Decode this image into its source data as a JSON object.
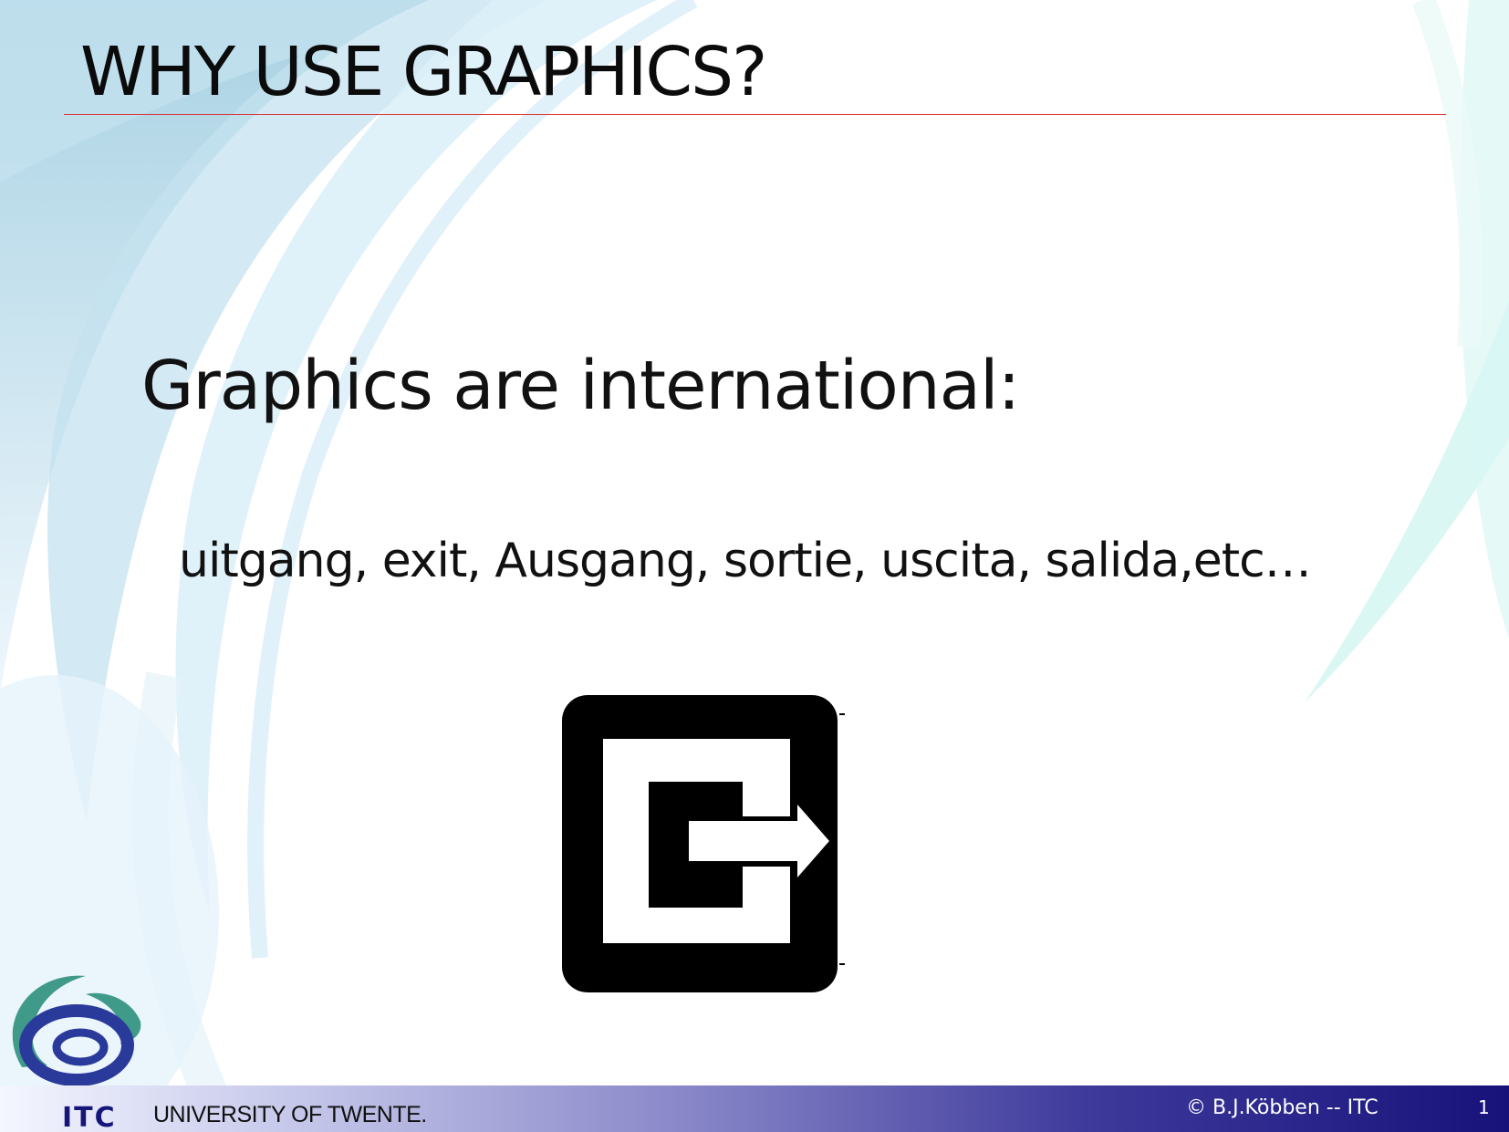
{
  "slide": {
    "title": "WHY USE GRAPHICS?",
    "heading": "Graphics are international:",
    "subtext": "uitgang, exit, Ausgang, sortie, uscita, salida,etc…"
  },
  "graphic": {
    "icon": "exit-sign-icon"
  },
  "footer": {
    "logo_text": "ITC",
    "university": "UNIVERSITY OF TWENTE.",
    "copyright": "© B.J.Köbben --  ITC",
    "page_number": "1"
  },
  "colors": {
    "title_rule": "#d83a3a",
    "swoosh_light": "#b7d9e8",
    "swoosh_pale": "#e3f4fb",
    "footer_dark": "#16127a",
    "logo_teal": "#3f9a8a",
    "logo_blue": "#2a3a9a"
  }
}
